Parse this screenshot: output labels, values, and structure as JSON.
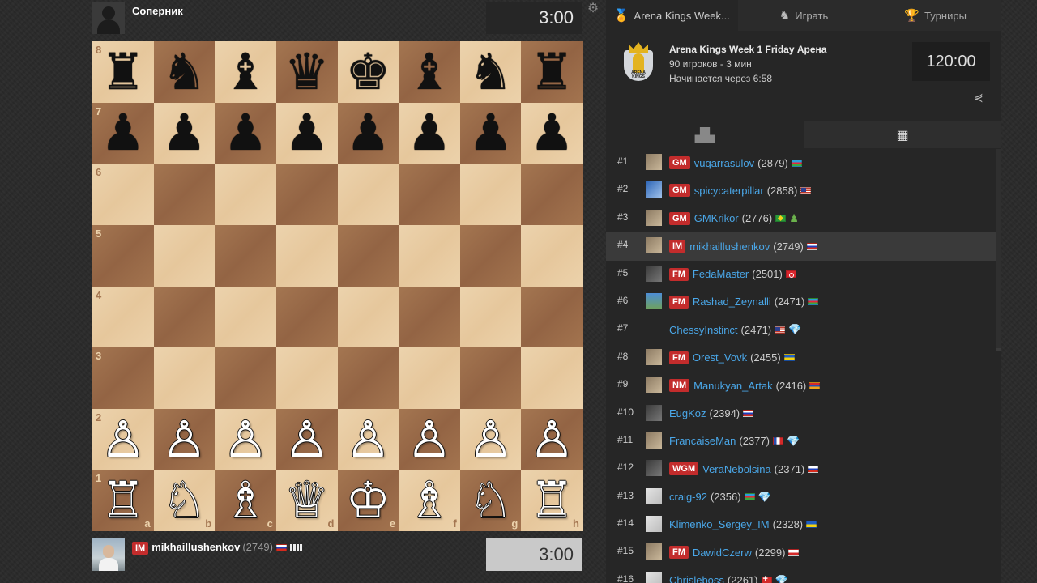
{
  "opponent": {
    "name": "Соперник",
    "clock": "3:00"
  },
  "player": {
    "title": "IM",
    "name": "mikhaillushenkov",
    "rating": "(2749)",
    "flag": "ru",
    "clock": "3:00"
  },
  "board": {
    "ranks": [
      "8",
      "7",
      "6",
      "5",
      "4",
      "3",
      "2",
      "1"
    ],
    "files": [
      "a",
      "b",
      "c",
      "d",
      "e",
      "f",
      "g",
      "h"
    ],
    "position": [
      [
        "♜",
        "♞",
        "♝",
        "♛",
        "♚",
        "♝",
        "♞",
        "♜"
      ],
      [
        "♟",
        "♟",
        "♟",
        "♟",
        "♟",
        "♟",
        "♟",
        "♟"
      ],
      [
        "",
        "",
        "",
        "",
        "",
        "",
        "",
        ""
      ],
      [
        "",
        "",
        "",
        "",
        "",
        "",
        "",
        ""
      ],
      [
        "",
        "",
        "",
        "",
        "",
        "",
        "",
        ""
      ],
      [
        "",
        "",
        "",
        "",
        "",
        "",
        "",
        ""
      ],
      [
        "♙",
        "♙",
        "♙",
        "♙",
        "♙",
        "♙",
        "♙",
        "♙"
      ],
      [
        "♖",
        "♘",
        "♗",
        "♕",
        "♔",
        "♗",
        "♘",
        "♖"
      ]
    ]
  },
  "tabs": [
    {
      "label": "Arena Kings Week...",
      "icon": "medal-icon"
    },
    {
      "label": "Играть",
      "icon": "play-icon"
    },
    {
      "label": "Турниры",
      "icon": "trophy-icon"
    }
  ],
  "tournament": {
    "name": "Arena Kings Week 1 Friday Арена",
    "players": "90 игроков - 3 мин",
    "starts": "Начинается через 6:58",
    "clock": "120:00",
    "logo_text": "ARENA KINGS"
  },
  "standings": [
    {
      "rank": "#1",
      "title": "GM",
      "name": "vuqarrasulov",
      "rating": "(2879)",
      "flag": "az",
      "avatar": "photo"
    },
    {
      "rank": "#2",
      "title": "GM",
      "name": "spicycaterpillar",
      "rating": "(2858)",
      "flag": "us",
      "avatar": "blue"
    },
    {
      "rank": "#3",
      "title": "GM",
      "name": "GMKrikor",
      "rating": "(2776)",
      "flag": "br",
      "extra": "pawn",
      "avatar": "photo"
    },
    {
      "rank": "#4",
      "title": "IM",
      "name": "mikhaillushenkov",
      "rating": "(2749)",
      "flag": "ru",
      "avatar": "photo",
      "me": true
    },
    {
      "rank": "#5",
      "title": "FM",
      "name": "FedaMaster",
      "rating": "(2501)",
      "flag": "tr",
      "avatar": "dark"
    },
    {
      "rank": "#6",
      "title": "FM",
      "name": "Rashad_Zeynalli",
      "rating": "(2471)",
      "flag": "az",
      "avatar": "sky"
    },
    {
      "rank": "#7",
      "title": "",
      "name": "ChessyInstinct",
      "rating": "(2471)",
      "flag": "us",
      "extra": "diamond",
      "avatar": "none"
    },
    {
      "rank": "#8",
      "title": "FM",
      "name": "Orest_Vovk",
      "rating": "(2455)",
      "flag": "ua",
      "avatar": "photo"
    },
    {
      "rank": "#9",
      "title": "NM",
      "name": "Manukyan_Artak",
      "rating": "(2416)",
      "flag": "am",
      "avatar": "photo"
    },
    {
      "rank": "#10",
      "title": "",
      "name": "EugKoz",
      "rating": "(2394)",
      "flag": "ru",
      "avatar": "dark"
    },
    {
      "rank": "#11",
      "title": "",
      "name": "FrancaiseMan",
      "rating": "(2377)",
      "flag": "fr",
      "extra": "diamond",
      "avatar": "photo"
    },
    {
      "rank": "#12",
      "title": "WGM",
      "name": "VeraNebolsina",
      "rating": "(2371)",
      "flag": "ru",
      "avatar": "dark"
    },
    {
      "rank": "#13",
      "title": "",
      "name": "craig-92",
      "rating": "(2356)",
      "flag": "az",
      "extra": "diamond",
      "avatar": "white"
    },
    {
      "rank": "#14",
      "title": "",
      "name": "Klimenko_Sergey_IM",
      "rating": "(2328)",
      "flag": "ua",
      "avatar": "white"
    },
    {
      "rank": "#15",
      "title": "FM",
      "name": "DawidCzerw",
      "rating": "(2299)",
      "flag": "pl",
      "avatar": "photo"
    },
    {
      "rank": "#16",
      "title": "",
      "name": "Chrisleboss",
      "rating": "(2261)",
      "flag": "ch",
      "extra": "diamond",
      "avatar": "white"
    }
  ]
}
